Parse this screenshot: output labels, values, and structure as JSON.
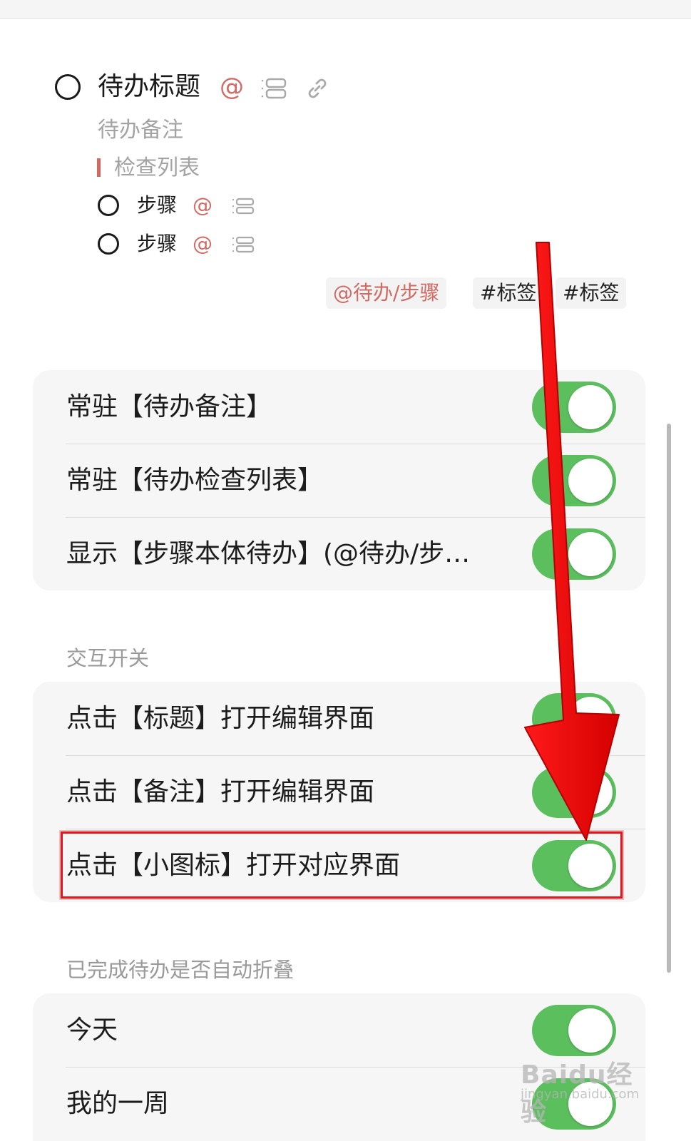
{
  "preview": {
    "title": "待办标题",
    "mention_symbol": "@",
    "note": "待办备注",
    "checklist": "检查列表",
    "steps": [
      {
        "label": "步骤",
        "mention": "@"
      },
      {
        "label": "步骤",
        "mention": "@"
      }
    ],
    "tags": [
      "@待办/步骤",
      "#标签",
      "#标签"
    ]
  },
  "groups": [
    {
      "title": "",
      "rows": [
        {
          "label": "常驻【待办备注】",
          "on": true
        },
        {
          "label": "常驻【待办检查列表】",
          "on": true
        },
        {
          "label": "显示【步骤本体待办】(@待办/步…",
          "on": true
        }
      ]
    },
    {
      "title": "交互开关",
      "rows": [
        {
          "label": "点击【标题】打开编辑界面",
          "on": true
        },
        {
          "label": "点击【备注】打开编辑界面",
          "on": true
        },
        {
          "label": "点击【小图标】打开对应界面",
          "on": true
        }
      ]
    },
    {
      "title": "已完成待办是否自动折叠",
      "rows": [
        {
          "label": "今天",
          "on": true
        },
        {
          "label": "我的一周",
          "on": true
        }
      ]
    }
  ],
  "colors": {
    "accent_red": "#d26a63",
    "toggle_on": "#5cbf5e",
    "annotation_red": "#e3161b"
  },
  "icons": [
    "list-icon",
    "link-icon"
  ],
  "watermark": {
    "main": "Baidu经验",
    "sub": "jingyan.baidu.com"
  }
}
